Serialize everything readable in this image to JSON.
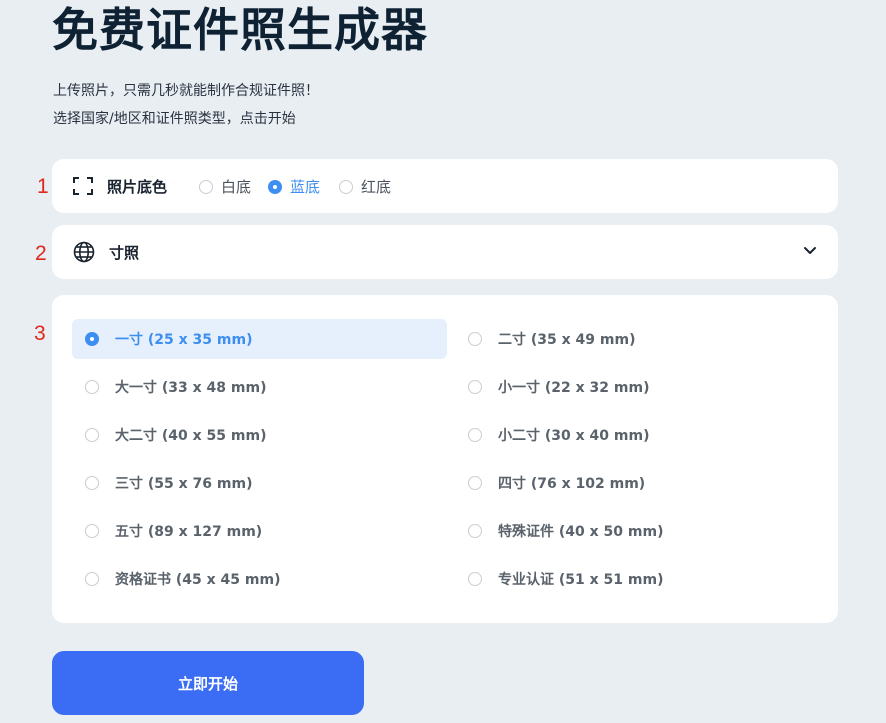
{
  "header": {
    "title": "免费证件照生成器",
    "subtitle_line1": "上传照片，只需几秒就能制作合规证件照！",
    "subtitle_line2": "选择国家/地区和证件照类型，点击开始"
  },
  "annotations": [
    "1",
    "2",
    "3"
  ],
  "background_color": {
    "label": "照片底色",
    "icon": "frame-icon",
    "options": [
      {
        "label": "白底",
        "selected": false
      },
      {
        "label": "蓝底",
        "selected": true
      },
      {
        "label": "红底",
        "selected": false
      }
    ]
  },
  "size_select": {
    "label": "寸照",
    "icon": "globe-icon",
    "chevron": "chevron-down-icon"
  },
  "size_options": [
    {
      "label": "一寸 (25 x 35 mm)",
      "selected": true
    },
    {
      "label": "二寸 (35 x 49 mm)",
      "selected": false
    },
    {
      "label": "大一寸 (33 x 48 mm)",
      "selected": false
    },
    {
      "label": "小一寸 (22 x 32 mm)",
      "selected": false
    },
    {
      "label": "大二寸 (40 x 55 mm)",
      "selected": false
    },
    {
      "label": "小二寸 (30 x 40 mm)",
      "selected": false
    },
    {
      "label": "三寸 (55 x 76 mm)",
      "selected": false
    },
    {
      "label": "四寸 (76 x 102 mm)",
      "selected": false
    },
    {
      "label": "五寸 (89 x 127 mm)",
      "selected": false
    },
    {
      "label": "特殊证件 (40 x 50 mm)",
      "selected": false
    },
    {
      "label": "资格证书 (45 x 45 mm)",
      "selected": false
    },
    {
      "label": "专业认证 (51 x 51 mm)",
      "selected": false
    }
  ],
  "start_button": {
    "label": "立即开始"
  },
  "colors": {
    "accent": "#3c8ff0",
    "button": "#3a6cf4",
    "page_bg": "#e9eef3",
    "selected_row_bg": "#e6effc",
    "annotation": "#e0271d"
  }
}
